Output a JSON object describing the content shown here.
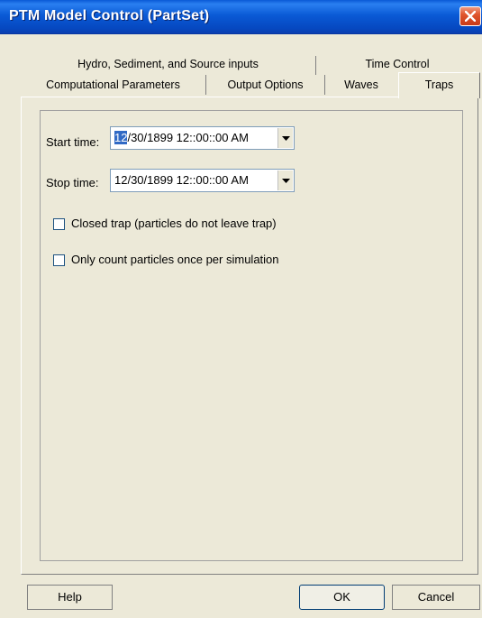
{
  "window": {
    "title": "PTM Model Control (PartSet)"
  },
  "tabs": {
    "row1": [
      {
        "id": "hydro",
        "label": "Hydro, Sediment, and Source inputs"
      },
      {
        "id": "time",
        "label": "Time Control"
      }
    ],
    "row2": [
      {
        "id": "computational",
        "label": "Computational Parameters"
      },
      {
        "id": "output",
        "label": "Output Options"
      },
      {
        "id": "waves",
        "label": "Waves"
      },
      {
        "id": "traps",
        "label": "Traps",
        "active": true
      }
    ]
  },
  "traps": {
    "start_label": "Start time:",
    "start_value_selected": "12",
    "start_value_rest": "/30/1899 12::00::00 AM",
    "stop_label": "Stop time:",
    "stop_value": "12/30/1899 12::00::00 AM",
    "closed_trap_label": "Closed trap (particles do not leave trap)",
    "closed_trap_checked": false,
    "count_once_label": "Only count particles once per simulation",
    "count_once_checked": false
  },
  "buttons": {
    "help": "Help",
    "ok": "OK",
    "cancel": "Cancel"
  },
  "icons": {
    "close": "close-icon",
    "dropdown": "chevron-down-icon"
  },
  "colors": {
    "titlebar": "#0a5ad6",
    "close": "#e0552d",
    "selection": "#316ac5",
    "face": "#ece9d8"
  }
}
